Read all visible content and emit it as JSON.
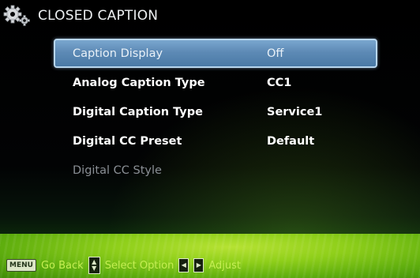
{
  "header": {
    "title": "CLOSED CAPTION",
    "icon": "gear-icon"
  },
  "menu": {
    "items": [
      {
        "label": "Caption Display",
        "value": "Off",
        "state": "selected"
      },
      {
        "label": "Analog Caption Type",
        "value": "CC1",
        "state": "normal"
      },
      {
        "label": "Digital Caption Type",
        "value": "Service1",
        "state": "normal"
      },
      {
        "label": "Digital CC Preset",
        "value": "Default",
        "state": "normal"
      },
      {
        "label": "Digital CC Style",
        "value": "",
        "state": "disabled"
      }
    ]
  },
  "help": {
    "menu_key": "MENU",
    "go_back": "Go Back",
    "select_option": "Select Option",
    "adjust": "Adjust"
  },
  "colors": {
    "selected_bg": "#5d8ab5",
    "band_green": "#8fcf1a",
    "text": "#ffffff",
    "disabled_text": "#8a8f95"
  }
}
